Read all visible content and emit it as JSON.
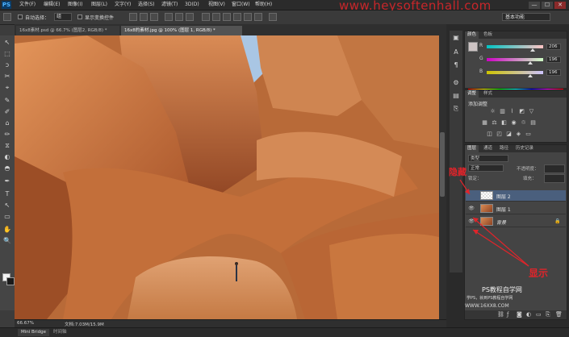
{
  "app": {
    "logo": "PS",
    "watermark": "www.heysoftenhall.com"
  },
  "menu": [
    "文件(F)",
    "编辑(E)",
    "图像(I)",
    "图层(L)",
    "文字(Y)",
    "选择(S)",
    "滤镜(T)",
    "3D(D)",
    "视图(V)",
    "窗口(W)",
    "帮助(H)"
  ],
  "window_controls": [
    "—",
    "☐",
    "✕"
  ],
  "options_bar": {
    "auto_select_label": "自动选择：",
    "auto_select_value": "组",
    "show_transform_label": "显示变换控件",
    "workspace": "基本功能"
  },
  "doc_tabs": [
    {
      "label": "16x8素材.psd @ 66.7% (图层2, RGB/8) *",
      "active": false
    },
    {
      "label": "16x8的素材.jpg @ 100% (图层 1, RGB/8) *",
      "active": true
    }
  ],
  "tools": [
    "↖",
    "⬚",
    "ↄ",
    "✂",
    "⌖",
    "✎",
    "✐",
    "⌂",
    "✏",
    "⧖",
    "◐",
    "◓",
    "✒",
    "T",
    "↖",
    "▭",
    "✋",
    "🔍"
  ],
  "status": {
    "zoom": "66.67%",
    "doc": "文档:7.03M/15.9M"
  },
  "bottom_tabs": [
    "Mini Bridge",
    "时间轴"
  ],
  "right_icon_strip": [
    "▣",
    "A",
    "¶",
    "⚙",
    "▤",
    "⎘"
  ],
  "color_panel": {
    "tabs": [
      "颜色",
      "色板"
    ],
    "sliders": [
      {
        "label": "R",
        "value": "206",
        "fraction": 0.81
      },
      {
        "label": "G",
        "value": "196",
        "fraction": 0.77
      },
      {
        "label": "B",
        "value": "196",
        "fraction": 0.77
      }
    ],
    "swatch_fg": "#cec4c4"
  },
  "adjust_panel": {
    "tabs": [
      "调整",
      "样式"
    ],
    "title": "添加调整"
  },
  "layers_panel": {
    "tabs": [
      "图层",
      "通道",
      "路径",
      "历史记录"
    ],
    "filter_label": "类型",
    "blend_mode": "正常",
    "opacity_label": "不透明度：",
    "lock_label": "锁定：",
    "fill_label": "填充：",
    "layers": [
      {
        "name": "图层 2",
        "selected": true,
        "eye": "",
        "thumb": "transparent"
      },
      {
        "name": "图层 1",
        "selected": false,
        "eye": "👁",
        "thumb": "photo"
      },
      {
        "name": "背景",
        "selected": false,
        "eye": "👁",
        "thumb": "photo",
        "lock": "🔒"
      }
    ]
  },
  "annotations": {
    "hide": "隐藏",
    "show": "显示"
  },
  "site_mark": {
    "line1": "PS教程自学网",
    "line2": "学PS，就到PS教程自学网",
    "line3": "WWW.16XX8.COM"
  },
  "colors": {
    "accent_red": "#e0242a",
    "panel_bg": "#444444",
    "selected_layer": "#4a5f7d"
  }
}
